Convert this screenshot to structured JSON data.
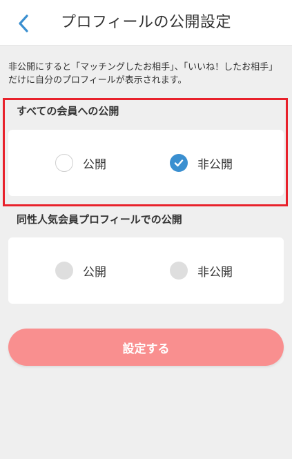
{
  "header": {
    "title": "プロフィールの公開設定",
    "back_icon": "chevron-left-icon"
  },
  "description": "非公開にすると「マッチングしたお相手」、「いいね！したお相手」だけに自分のプロフィールが表示されます。",
  "section_all": {
    "title": "すべての会員への公開",
    "options": [
      {
        "label": "公開",
        "state": "unselected"
      },
      {
        "label": "非公開",
        "state": "selected"
      }
    ]
  },
  "section_same_sex": {
    "title": "同性人気会員プロフィールでの公開",
    "options": [
      {
        "label": "公開",
        "state": "disabled"
      },
      {
        "label": "非公開",
        "state": "disabled"
      }
    ]
  },
  "submit_label": "設定する",
  "colors": {
    "accent_blue": "#3a8fd0",
    "button_pink": "#f98f8f",
    "highlight_red": "#e8212b",
    "background": "#efefef"
  }
}
